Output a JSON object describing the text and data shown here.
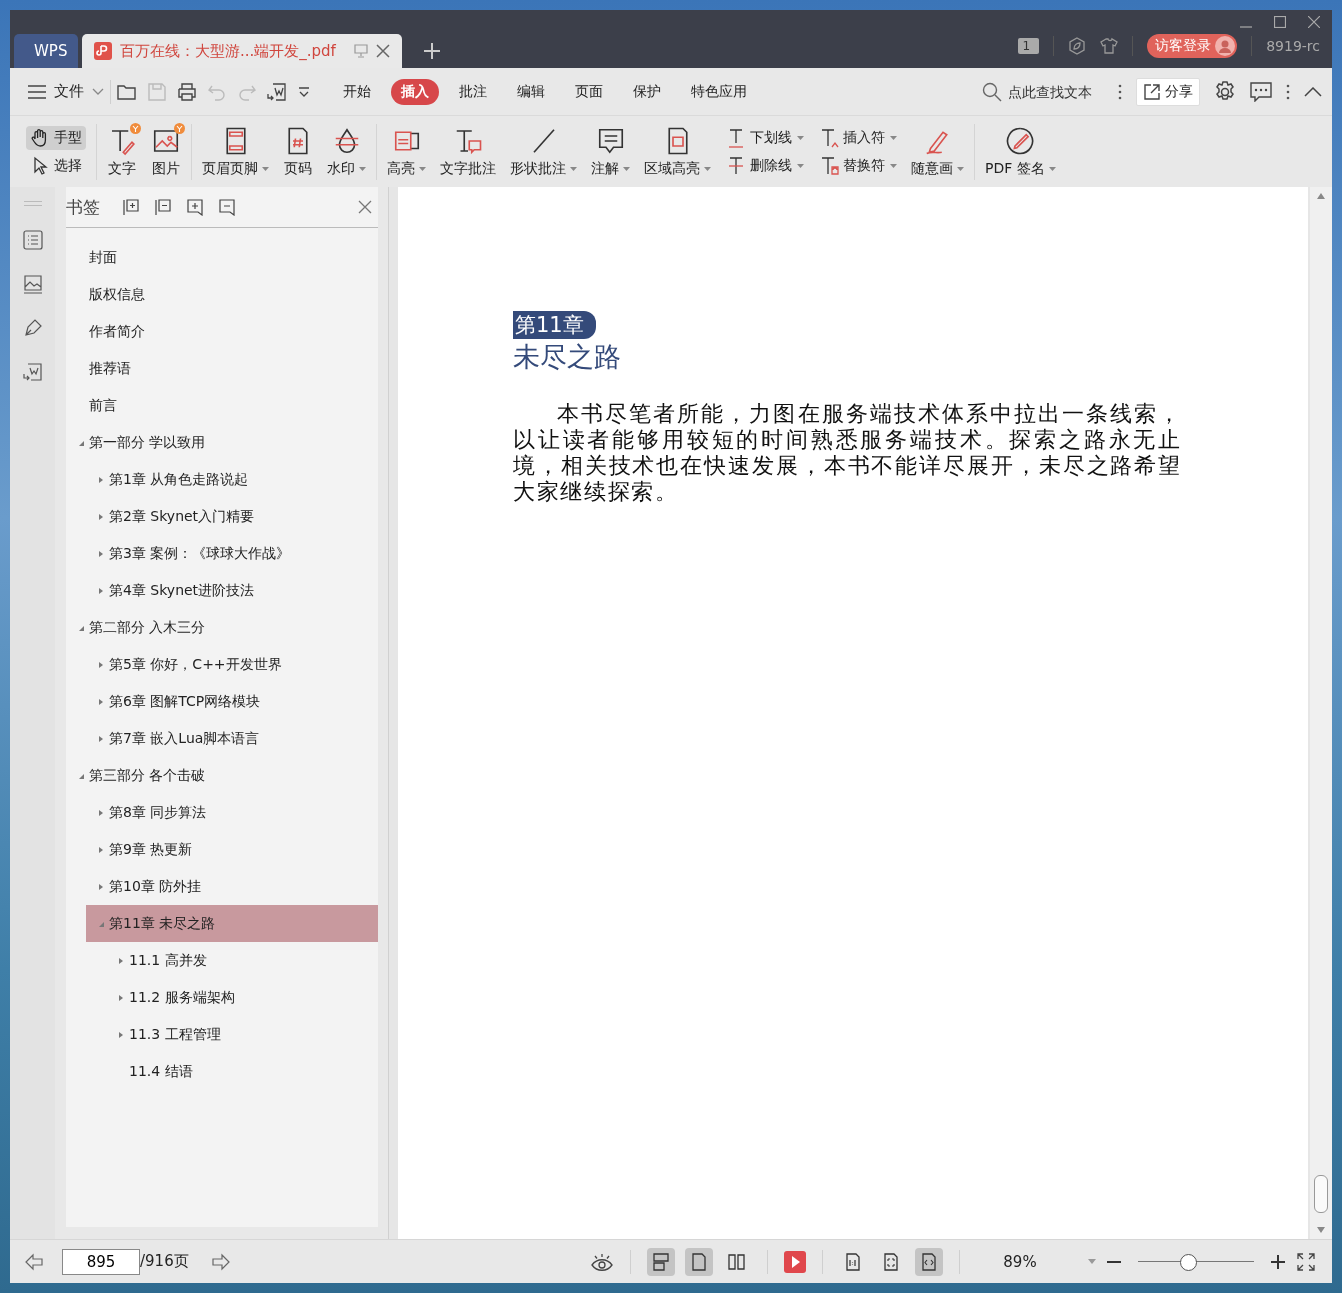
{
  "window": {
    "tabs": [
      {
        "label": "WPS",
        "selected": false,
        "kind": "home"
      },
      {
        "label": "百万在线：大型游...端开发_.pdf",
        "selected": true,
        "kind": "document"
      }
    ],
    "page_count_badge": "1",
    "login_button": "访客登录",
    "user_label": "8919-rc"
  },
  "menu": {
    "file_menu": "文件",
    "tabs": [
      {
        "label": "开始",
        "selected": false
      },
      {
        "label": "插入",
        "selected": true
      },
      {
        "label": "批注",
        "selected": false
      },
      {
        "label": "编辑",
        "selected": false
      },
      {
        "label": "页面",
        "selected": false
      },
      {
        "label": "保护",
        "selected": false
      },
      {
        "label": "特色应用",
        "selected": false
      }
    ],
    "search": {
      "placeholder": "点此查找文本"
    },
    "share_button": "分享"
  },
  "ribbon": {
    "pointer_tools": [
      {
        "label": "手型",
        "selected": true
      },
      {
        "label": "选择",
        "selected": false
      }
    ],
    "groups": [
      {
        "items": [
          {
            "kind": "large",
            "label": "文字",
            "dropdown": false,
            "badge": true
          },
          {
            "kind": "large",
            "label": "图片",
            "dropdown": false,
            "badge": true
          }
        ]
      },
      {
        "items": [
          {
            "kind": "large",
            "label": "页眉页脚",
            "dropdown": true,
            "badge": false
          },
          {
            "kind": "large",
            "label": "页码",
            "dropdown": false,
            "badge": false
          },
          {
            "kind": "large",
            "label": "水印",
            "dropdown": true,
            "badge": false
          }
        ]
      },
      {
        "items": [
          {
            "kind": "large",
            "label": "高亮",
            "dropdown": true,
            "badge": false
          },
          {
            "kind": "large",
            "label": "文字批注",
            "dropdown": false,
            "badge": false
          },
          {
            "kind": "large",
            "label": "形状批注",
            "dropdown": true,
            "badge": false
          },
          {
            "kind": "large",
            "label": "注解",
            "dropdown": true,
            "badge": false
          },
          {
            "kind": "large",
            "label": "区域高亮",
            "dropdown": true,
            "badge": false
          },
          {
            "kind": "stack",
            "items": [
              {
                "label": "下划线",
                "dropdown": true
              },
              {
                "label": "删除线",
                "dropdown": true
              }
            ]
          },
          {
            "kind": "stack",
            "items": [
              {
                "label": "插入符",
                "dropdown": true
              },
              {
                "label": "替换符",
                "dropdown": true
              }
            ]
          },
          {
            "kind": "large",
            "label": "随意画",
            "dropdown": true,
            "badge": false
          }
        ]
      },
      {
        "items": [
          {
            "kind": "large",
            "label": "PDF 签名",
            "dropdown": true,
            "badge": false
          }
        ]
      }
    ]
  },
  "bookmarks": {
    "title": "书签",
    "items": [
      {
        "label": "封面",
        "kind": "leaf",
        "selected": false
      },
      {
        "label": "版权信息",
        "kind": "leaf",
        "selected": false
      },
      {
        "label": "作者简介",
        "kind": "leaf",
        "selected": false
      },
      {
        "label": "推荐语",
        "kind": "leaf",
        "selected": false
      },
      {
        "label": "前言",
        "kind": "leaf",
        "selected": false
      },
      {
        "label": "第一部分 学以致用",
        "kind": "branch",
        "expanded": true,
        "selected": false,
        "children": [
          {
            "label": "第1章 从角色走路说起",
            "kind": "branch",
            "expanded": false,
            "selected": false
          },
          {
            "label": "第2章 Skynet入门精要",
            "kind": "branch",
            "expanded": false,
            "selected": false
          },
          {
            "label": "第3章 案例：《球球大作战》",
            "kind": "branch",
            "expanded": false,
            "selected": false
          },
          {
            "label": "第4章 Skynet进阶技法",
            "kind": "branch",
            "expanded": false,
            "selected": false
          }
        ]
      },
      {
        "label": "第二部分 入木三分",
        "kind": "branch",
        "expanded": true,
        "selected": false,
        "children": [
          {
            "label": "第5章 你好，C++开发世界",
            "kind": "branch",
            "expanded": false,
            "selected": false
          },
          {
            "label": "第6章 图解TCP网络模块",
            "kind": "branch",
            "expanded": false,
            "selected": false
          },
          {
            "label": "第7章 嵌入Lua脚本语言",
            "kind": "branch",
            "expanded": false,
            "selected": false
          }
        ]
      },
      {
        "label": "第三部分 各个击破",
        "kind": "branch",
        "expanded": true,
        "selected": false,
        "children": [
          {
            "label": "第8章 同步算法",
            "kind": "branch",
            "expanded": false,
            "selected": false
          },
          {
            "label": "第9章 热更新",
            "kind": "branch",
            "expanded": false,
            "selected": false
          },
          {
            "label": "第10章 防外挂",
            "kind": "branch",
            "expanded": false,
            "selected": false
          },
          {
            "label": "第11章 未尽之路",
            "kind": "branch",
            "expanded": true,
            "selected": true,
            "children": [
              {
                "label": "11.1 高并发",
                "kind": "branch",
                "expanded": false,
                "selected": false
              },
              {
                "label": "11.2 服务端架构",
                "kind": "branch",
                "expanded": false,
                "selected": false
              },
              {
                "label": "11.3 工程管理",
                "kind": "branch",
                "expanded": false,
                "selected": false
              },
              {
                "label": "11.4 结语",
                "kind": "leaf",
                "selected": false
              }
            ]
          }
        ]
      }
    ]
  },
  "document": {
    "chapter_label": "第11章",
    "chapter_title": "未尽之路",
    "paragraph": "本书尽笔者所能，力图在服务端技术体系中拉出一条线索，以让读者能够用较短的时间熟悉服务端技术。探索之路永无止境，相关技术也在快速发展，本书不能详尽展开，未尽之路希望大家继续探索。"
  },
  "status_bar": {
    "page_input": "895",
    "page_total": "/916页",
    "view_modes": [
      {
        "selected": true
      },
      {
        "selected": true
      },
      {
        "selected": false
      }
    ],
    "fit_modes": [
      {
        "selected": false
      },
      {
        "selected": false
      },
      {
        "selected": true
      }
    ],
    "zoom_label": "89%",
    "zoom": {
      "level": 0.43
    }
  }
}
